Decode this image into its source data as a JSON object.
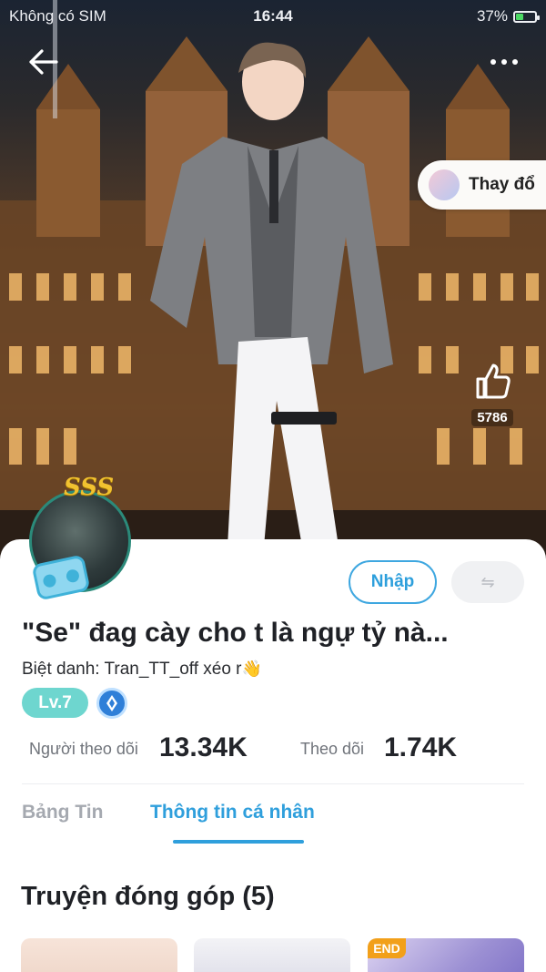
{
  "status_bar": {
    "carrier": "Không có SIM",
    "time": "16:44",
    "battery": "37%",
    "battery_level": 0.37
  },
  "nav": {
    "back_icon": "arrow-left-icon",
    "more_icon": "more-horizontal-icon"
  },
  "hero": {
    "change_label": "Thay đổ",
    "like_count": "5786"
  },
  "profile": {
    "name": "\"Se\" đag cày cho t là ngự tỷ nà...",
    "nickname": "Biệt danh: Tran_TT_off xéo r",
    "wave_emoji": "👋",
    "avatar_frame_text": "SSS",
    "level": "Lv.7",
    "import_button": "Nhập",
    "switch_icon": "⇋"
  },
  "stats": {
    "followers_label": "Người theo dõi",
    "followers_value": "13.34K",
    "following_label": "Theo dõi",
    "following_value": "1.74K"
  },
  "tabs": [
    {
      "label": "Bảng Tin",
      "active": false
    },
    {
      "label": "Thông tin cá nhân",
      "active": true
    }
  ],
  "section": {
    "title": "Truyện đóng góp (5)"
  },
  "cards": [
    {
      "badge": ""
    },
    {
      "badge": ""
    },
    {
      "badge": "END"
    }
  ],
  "colors": {
    "accent": "#2f9fdc",
    "level_badge": "#6ed6cf",
    "end_badge": "#f2a01a"
  }
}
